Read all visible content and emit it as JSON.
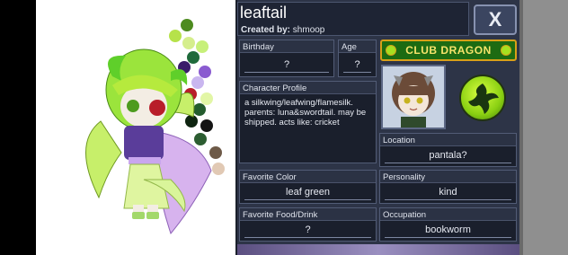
{
  "header": {
    "title": "leaftail",
    "created_by_label": "Created by:",
    "creator": "shmoop",
    "close_label": "X"
  },
  "fields": {
    "birthday": {
      "label": "Birthday",
      "value": "?"
    },
    "age": {
      "label": "Age",
      "value": "?"
    },
    "profile": {
      "label": "Character Profile",
      "text": "a silkwing/leafwing/flamesilk.\nparents: luna&swordtail. may be\nshipped. acts like: cricket"
    },
    "favorite_color": {
      "label": "Favorite Color",
      "value": "leaf green"
    },
    "favorite_food": {
      "label": "Favorite Food/Drink",
      "value": "?"
    },
    "location": {
      "label": "Location",
      "value": "pantala?"
    },
    "personality": {
      "label": "Personality",
      "value": "kind"
    },
    "occupation": {
      "label": "Occupation",
      "value": "bookworm"
    }
  },
  "club": {
    "name": "CLUB DRAGON",
    "emblem_icon": "dragon-emblem-icon"
  },
  "palette": [
    "#4d8b1f",
    "#b6e24a",
    "#d5ee8c",
    "#c7f07a",
    "#1f6a3a",
    "#3a1d6a",
    "#8a5bd0",
    "#c9b6ef",
    "#b81d2a",
    "#e2f6a6",
    "#245c2e",
    "#0e2410",
    "#151515",
    "#2c5d31",
    "#6e5a48",
    "#e1c9b4"
  ],
  "colors": {
    "panel": "#2d3447",
    "field": "#1a1f2c",
    "accent_gold": "#d8a018",
    "accent_green": "#1d6b12"
  }
}
